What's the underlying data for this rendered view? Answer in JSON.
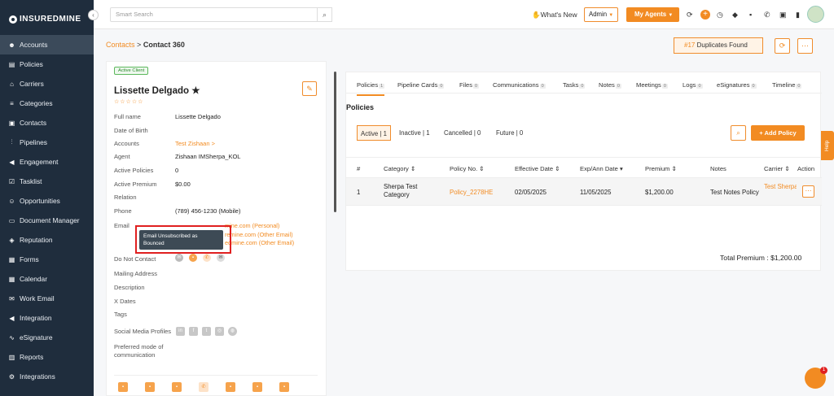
{
  "brand": "INSUREDMINE",
  "sidebar": {
    "items": [
      {
        "label": "Accounts",
        "icon": "person-icon",
        "active": true
      },
      {
        "label": "Policies",
        "icon": "doc-icon"
      },
      {
        "label": "Carriers",
        "icon": "bank-icon"
      },
      {
        "label": "Categories",
        "icon": "list-icon"
      },
      {
        "label": "Contacts",
        "icon": "contact-icon"
      },
      {
        "label": "Pipelines",
        "icon": "pipeline-icon"
      },
      {
        "label": "Engagement",
        "icon": "megaphone-icon"
      },
      {
        "label": "Tasklist",
        "icon": "task-icon"
      },
      {
        "label": "Opportunities",
        "icon": "people-icon"
      },
      {
        "label": "Document Manager",
        "icon": "folder-icon"
      },
      {
        "label": "Reputation",
        "icon": "reputation-icon"
      },
      {
        "label": "Forms",
        "icon": "form-icon"
      },
      {
        "label": "Calendar",
        "icon": "calendar-icon"
      },
      {
        "label": "Work Email",
        "icon": "mail-icon"
      },
      {
        "label": "Integration",
        "icon": "megaphone-icon"
      },
      {
        "label": "eSignature",
        "icon": "signature-icon"
      },
      {
        "label": "Reports",
        "icon": "chart-icon"
      },
      {
        "label": "Integrations",
        "icon": "gear-icon"
      }
    ]
  },
  "topbar": {
    "search_placeholder": "Smart Search",
    "whats_new": "What's New",
    "admin": "Admin",
    "my_agents": "My Agents"
  },
  "breadcrumb": {
    "link": "Contacts",
    "sep": ">",
    "current": "Contact 360"
  },
  "duplicates": {
    "count": "#17",
    "label": "Duplicates Found"
  },
  "contact": {
    "badge": "Active Client",
    "name": "Lissette Delgado",
    "fields": [
      {
        "label": "Full name",
        "value": "Lissette Delgado"
      },
      {
        "label": "Date of Birth",
        "value": ""
      },
      {
        "label": "Accounts",
        "value": "Test Zishaan >"
      },
      {
        "label": "Agent",
        "value": "Zishaan IMSherpa_KOL"
      },
      {
        "label": "Active Policies",
        "value": "0"
      },
      {
        "label": "Active Premium",
        "value": "$0.00"
      },
      {
        "label": "Relation",
        "value": ""
      },
      {
        "label": "Phone",
        "value": "(789) 456-1230 (Mobile)"
      },
      {
        "label": "Email",
        "value": ""
      }
    ],
    "emails": [
      "mine.com (Personal)",
      "remine.com (Other Email)",
      "edmine.com (Other Email)"
    ],
    "tooltip": "Email Unsubscribed as Bounced",
    "more_fields": [
      "Do Not Contact",
      "Mailing Address",
      "Description",
      "X Dates",
      "Tags",
      "Social Media Profiles",
      "Preferred mode of communication"
    ]
  },
  "tabs": [
    {
      "label": "Policies",
      "count": "1"
    },
    {
      "label": "Pipeline Cards",
      "count": "0"
    },
    {
      "label": "Files",
      "count": "0"
    },
    {
      "label": "Communications",
      "count": "0"
    },
    {
      "label": "Tasks",
      "count": "0"
    },
    {
      "label": "Notes",
      "count": "0"
    },
    {
      "label": "Meetings",
      "count": "0"
    },
    {
      "label": "Logs",
      "count": "0"
    },
    {
      "label": "eSignatures",
      "count": "0"
    },
    {
      "label": "Timeline",
      "count": "0"
    }
  ],
  "policies": {
    "title": "Policies",
    "filters": [
      {
        "label": "Active",
        "count": "1"
      },
      {
        "label": "Inactive",
        "count": "1"
      },
      {
        "label": "Cancelled",
        "count": "0"
      },
      {
        "label": "Future",
        "count": "0"
      }
    ],
    "add_label": "+ Add Policy",
    "columns": [
      "#",
      "Category",
      "Policy No.",
      "Effective Date",
      "Exp/Ann Date",
      "Premium",
      "Notes",
      "Carrier",
      "Action"
    ],
    "rows": [
      {
        "num": "1",
        "category": "Sherpa Test Category",
        "policy_no": "Policy_2278HE",
        "effective": "02/05/2025",
        "exp": "11/05/2025",
        "premium": "$1,200.00",
        "notes": "Test Notes Policy",
        "carrier": "Test Sherpa Carrier"
      }
    ],
    "total": "Total Premium : $1,200.00"
  },
  "help": "Help",
  "chat_badge": "1"
}
